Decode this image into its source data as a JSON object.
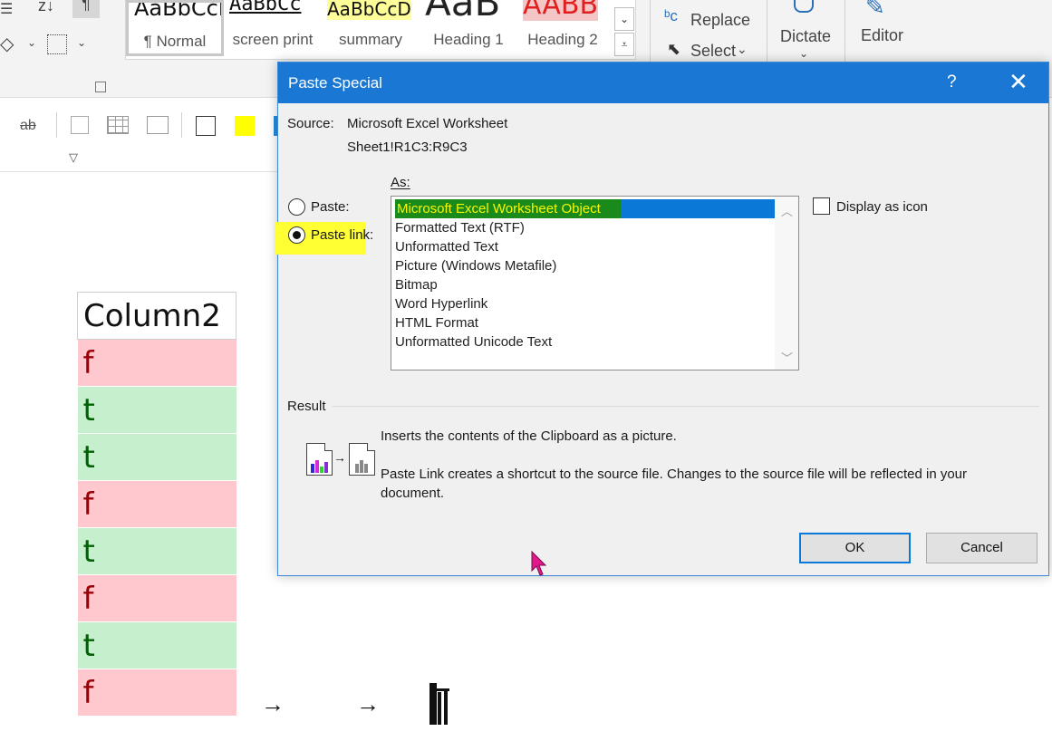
{
  "ribbon": {
    "styles": [
      {
        "preview": "AaBbCcI",
        "label": "¶ Normal"
      },
      {
        "preview": "AaBbCc",
        "label": "screen print"
      },
      {
        "preview": "AaBbCcD",
        "label": "summary"
      },
      {
        "preview": "AaB",
        "label": "Heading 1"
      },
      {
        "preview": "AABB",
        "label": "Heading 2"
      }
    ],
    "replace_label": "Replace",
    "select_label": "Select",
    "dictate_label": "Dictate",
    "editor_label": "Editor"
  },
  "document": {
    "column_header": "Column2",
    "cells": [
      "f",
      "t",
      "t",
      "f",
      "t",
      "f",
      "t",
      "f"
    ],
    "arrow_1": "→",
    "arrow_2": "→"
  },
  "dialog": {
    "title": "Paste Special",
    "help": "?",
    "close": "✕",
    "source_label": "Source:",
    "source_value": "Microsoft Excel Worksheet",
    "source_range": "Sheet1!R1C3:R9C3",
    "as_label": "As:",
    "paste_label": "Paste:",
    "paste_link_label": "Paste link:",
    "paste_selected": false,
    "paste_link_selected": true,
    "list_items": [
      "Microsoft Excel Worksheet Object",
      "Formatted Text (RTF)",
      "Unformatted Text",
      "Picture (Windows Metafile)",
      "Bitmap",
      "Word Hyperlink",
      "HTML Format",
      "Unformatted Unicode Text"
    ],
    "selected_index": 0,
    "display_as_icon_label": "Display as icon",
    "display_as_icon_checked": false,
    "result_label": "Result",
    "result_line1": "Inserts the contents of the Clipboard as a picture.",
    "result_line2a": "Paste Link creates a shortcut to the source file. Changes to the source file will be reflected in your",
    "result_line2b": "document.",
    "ok_label": "OK",
    "cancel_label": "Cancel"
  },
  "colors": {
    "titlebar": "#1a78d4",
    "highlight": "#ffff33",
    "selection": "#0a78d7",
    "false_fill": "#ffc7ce",
    "true_fill": "#c6efce"
  }
}
